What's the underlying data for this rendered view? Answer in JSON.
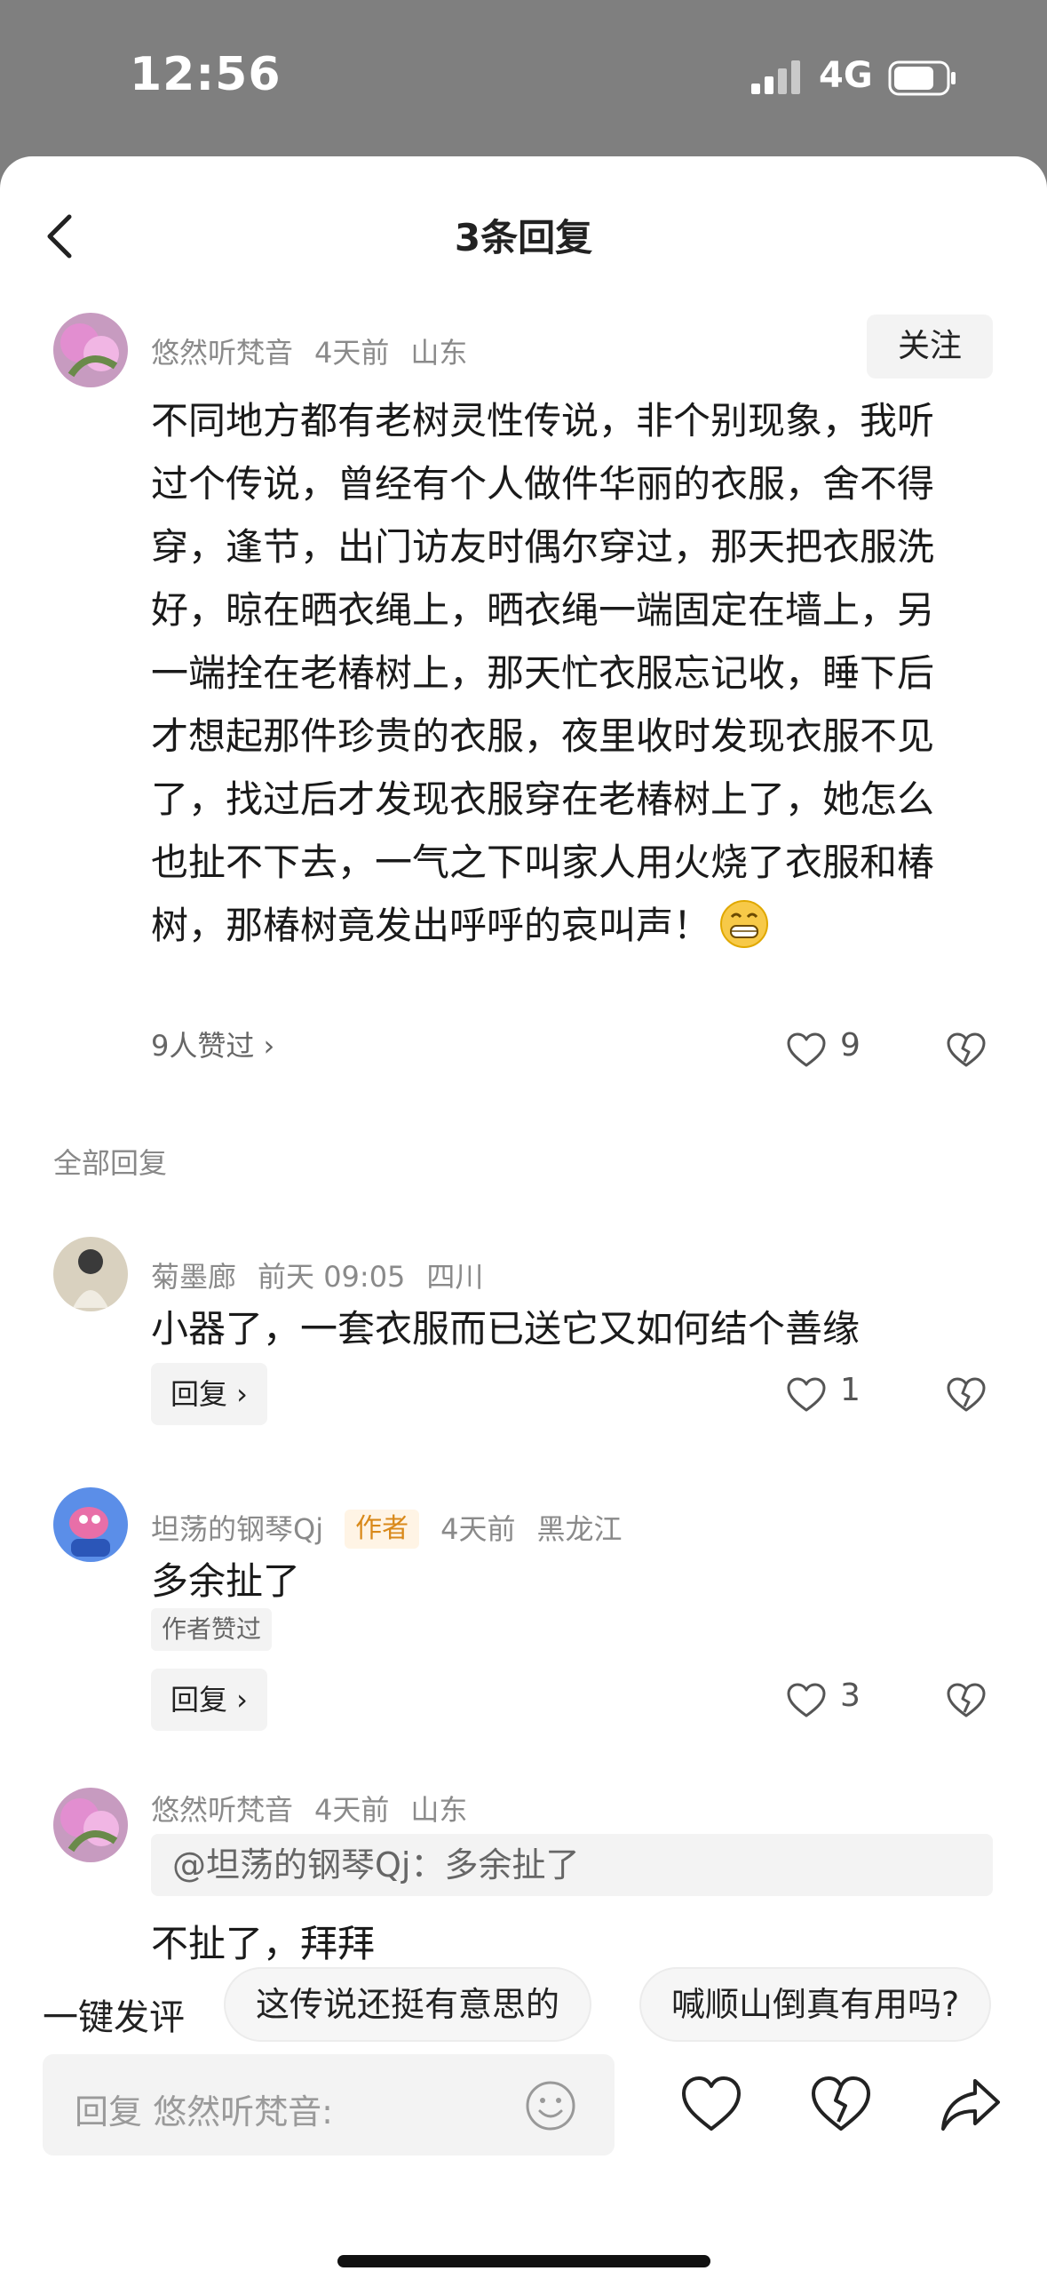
{
  "status_bar": {
    "time": "12:56",
    "network": "4G"
  },
  "header": {
    "title": "3条回复"
  },
  "main_comment": {
    "username": "悠然听梵音",
    "time": "4天前",
    "location": "山东",
    "follow_label": "关注",
    "text": "不同地方都有老树灵性传说，非个别现象，我听过个传说，曾经有个人做件华丽的衣服，舍不得穿，逢节，出门访友时偶尔穿过，那天把衣服洗好，晾在晒衣绳上，晒衣绳一端固定在墙上，另一端拴在老椿树上，那天忙衣服忘记收，睡下后才想起那件珍贵的衣服，夜里收时发现衣服不见了，找过后才发现衣服穿在老椿树上了，她怎么也扯不下去，一气之下叫家人用火烧了衣服和椿树，那椿树竟发出呼呼的哀叫声！",
    "likes_link": "9人赞过 ›",
    "like_count": "9"
  },
  "section_label": "全部回复",
  "replies": [
    {
      "username": "菊墨廊",
      "time": "前天 09:05",
      "location": "四川",
      "text": "小器了，一套衣服而已送它又如何结个善缘",
      "reply_label": "回复 ›",
      "like_count": "1"
    },
    {
      "username": "坦荡的钢琴Qj",
      "author_tag": "作者",
      "time": "4天前",
      "location": "黑龙江",
      "text": "多余扯了",
      "liked_tag": "作者赞过",
      "reply_label": "回复 ›",
      "like_count": "3"
    },
    {
      "username": "悠然听梵音",
      "time": "4天前",
      "location": "山东",
      "quote": "@坦荡的钢琴Qj：多余扯了",
      "text": "不扯了，拜拜"
    }
  ],
  "bottom_bar": {
    "quick_label": "一键发评",
    "suggestions": [
      "这传说还挺有意思的",
      "喊顺山倒真有用吗?"
    ],
    "input_placeholder": "回复 悠然听梵音:"
  },
  "colors": {
    "accent_tag_bg": "#fff4e5",
    "accent_tag_text": "#d9891a",
    "status_bg": "#7f7f7f"
  }
}
